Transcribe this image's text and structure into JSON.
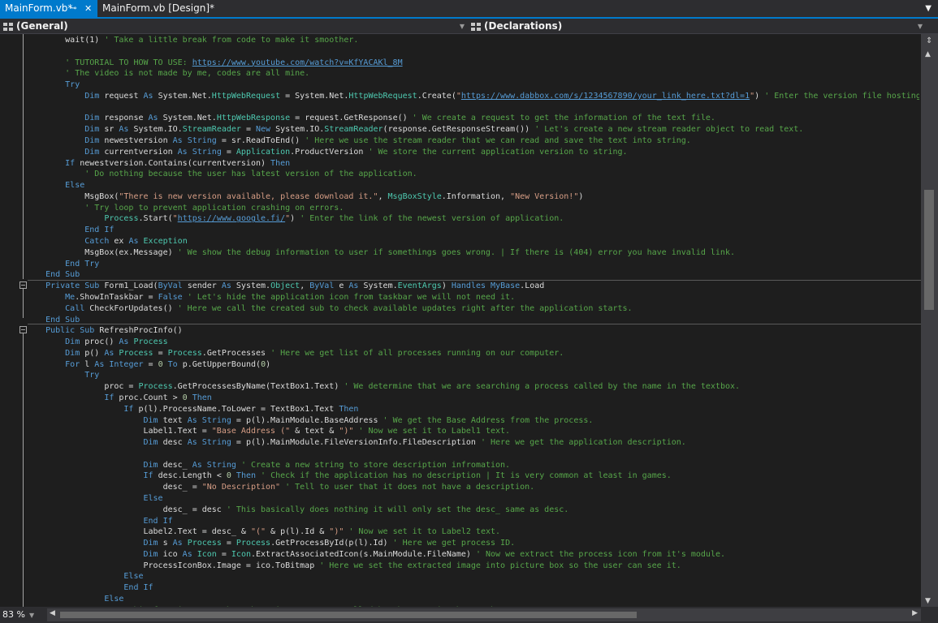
{
  "tabs": [
    {
      "label": "MainForm.vb*",
      "active": true,
      "pin_icon": "pin-icon",
      "close_icon": "close-icon"
    },
    {
      "label": "MainForm.vb [Design]*",
      "active": false
    }
  ],
  "navigation": {
    "left_label": "(General)",
    "right_label": "(Declarations)"
  },
  "zoom": "83 %",
  "colors": {
    "accent": "#007acc",
    "background": "#1e1e1e",
    "keyword": "#569cd6",
    "type": "#4ec9b0",
    "string": "#d69d85",
    "comment": "#57a64a"
  },
  "code_lines": [
    [
      [
        "p",
        "        wait(1) "
      ],
      [
        "c",
        "' Take a little break from code to make it smoother."
      ]
    ],
    [
      [
        "p",
        ""
      ]
    ],
    [
      [
        "c",
        "        ' TUTORIAL TO HOW TO USE: "
      ],
      [
        "u",
        "https://www.youtube.com/watch?v=KfYACAKl_8M"
      ]
    ],
    [
      [
        "c",
        "        ' The video is not made by me, codes are all mine."
      ]
    ],
    [
      [
        "k",
        "        Try"
      ]
    ],
    [
      [
        "k",
        "            Dim"
      ],
      [
        "p",
        " request "
      ],
      [
        "k",
        "As"
      ],
      [
        "p",
        " System.Net."
      ],
      [
        "t",
        "HttpWebRequest"
      ],
      [
        "p",
        " = System.Net."
      ],
      [
        "t",
        "HttpWebRequest"
      ],
      [
        "p",
        ".Create("
      ],
      [
        "s",
        "\""
      ],
      [
        "u",
        "https://www.dabbox.com/s/1234567890/your_link_here.txt?dl=1"
      ],
      [
        "s",
        "\""
      ],
      [
        "p",
        ") "
      ],
      [
        "c",
        "' Enter the version file hosting site li"
      ]
    ],
    [
      [
        "p",
        ""
      ]
    ],
    [
      [
        "k",
        "            Dim"
      ],
      [
        "p",
        " response "
      ],
      [
        "k",
        "As"
      ],
      [
        "p",
        " System.Net."
      ],
      [
        "t",
        "HttpWebResponse"
      ],
      [
        "p",
        " = request.GetResponse() "
      ],
      [
        "c",
        "' We create a request to get the information of the text file."
      ]
    ],
    [
      [
        "k",
        "            Dim"
      ],
      [
        "p",
        " sr "
      ],
      [
        "k",
        "As"
      ],
      [
        "p",
        " System.IO."
      ],
      [
        "t",
        "StreamReader"
      ],
      [
        "p",
        " = "
      ],
      [
        "k",
        "New"
      ],
      [
        "p",
        " System.IO."
      ],
      [
        "t",
        "StreamReader"
      ],
      [
        "p",
        "(response.GetResponseStream()) "
      ],
      [
        "c",
        "' Let's create a new stream reader object to read text."
      ]
    ],
    [
      [
        "k",
        "            Dim"
      ],
      [
        "p",
        " newestversion "
      ],
      [
        "k",
        "As"
      ],
      [
        "p",
        " "
      ],
      [
        "k",
        "String"
      ],
      [
        "p",
        " = sr.ReadToEnd() "
      ],
      [
        "c",
        "' Here we use the stream reader that we can read and save the text into string."
      ]
    ],
    [
      [
        "k",
        "            Dim"
      ],
      [
        "p",
        " currentversion "
      ],
      [
        "k",
        "As"
      ],
      [
        "p",
        " "
      ],
      [
        "k",
        "String"
      ],
      [
        "p",
        " = "
      ],
      [
        "t",
        "Application"
      ],
      [
        "p",
        ".ProductVersion "
      ],
      [
        "c",
        "' We store the current application version to string."
      ]
    ],
    [
      [
        "k",
        "        If"
      ],
      [
        "p",
        " newestversion.Contains(currentversion) "
      ],
      [
        "k",
        "Then"
      ]
    ],
    [
      [
        "c",
        "            ' Do nothing because the user has latest version of the application."
      ]
    ],
    [
      [
        "k",
        "        Else"
      ]
    ],
    [
      [
        "p",
        "            MsgBox("
      ],
      [
        "s",
        "\"There is new version available, please download it.\""
      ],
      [
        "p",
        ", "
      ],
      [
        "t",
        "MsgBoxStyle"
      ],
      [
        "p",
        ".Information, "
      ],
      [
        "s",
        "\"New Version!\""
      ],
      [
        "p",
        ")"
      ]
    ],
    [
      [
        "c",
        "            ' Try loop to prevent application crashing on errors."
      ]
    ],
    [
      [
        "p",
        "                "
      ],
      [
        "t",
        "Process"
      ],
      [
        "p",
        ".Start("
      ],
      [
        "s",
        "\""
      ],
      [
        "u",
        "https://www.google.fi/"
      ],
      [
        "s",
        "\""
      ],
      [
        "p",
        ") "
      ],
      [
        "c",
        "' Enter the link of the newest version of application."
      ]
    ],
    [
      [
        "k",
        "            End If"
      ]
    ],
    [
      [
        "k",
        "            Catch"
      ],
      [
        "p",
        " ex "
      ],
      [
        "k",
        "As"
      ],
      [
        "p",
        " "
      ],
      [
        "t",
        "Exception"
      ]
    ],
    [
      [
        "p",
        "            MsgBox(ex.Message) "
      ],
      [
        "c",
        "' We show the debug information to user if somethings goes wrong. | If there is (404) error you have invalid link."
      ]
    ],
    [
      [
        "k",
        "        End Try"
      ]
    ],
    [
      [
        "k",
        "    End Sub"
      ]
    ],
    [
      [
        "k",
        "    Private Sub"
      ],
      [
        "p",
        " Form1_Load("
      ],
      [
        "k",
        "ByVal"
      ],
      [
        "p",
        " sender "
      ],
      [
        "k",
        "As"
      ],
      [
        "p",
        " System."
      ],
      [
        "t",
        "Object"
      ],
      [
        "p",
        ", "
      ],
      [
        "k",
        "ByVal"
      ],
      [
        "p",
        " e "
      ],
      [
        "k",
        "As"
      ],
      [
        "p",
        " System."
      ],
      [
        "t",
        "EventArgs"
      ],
      [
        "p",
        ") "
      ],
      [
        "k",
        "Handles"
      ],
      [
        "p",
        " "
      ],
      [
        "k",
        "MyBase"
      ],
      [
        "p",
        ".Load"
      ]
    ],
    [
      [
        "k",
        "        Me"
      ],
      [
        "p",
        ".ShowInTaskbar = "
      ],
      [
        "k",
        "False"
      ],
      [
        "p",
        " "
      ],
      [
        "c",
        "' Let's hide the application icon from taskbar we will not need it."
      ]
    ],
    [
      [
        "k",
        "        Call"
      ],
      [
        "p",
        " CheckForUpdates() "
      ],
      [
        "c",
        "' Here we call the created sub to check available updates right after the application starts."
      ]
    ],
    [
      [
        "k",
        "    End Sub"
      ]
    ],
    [
      [
        "k",
        "    Public Sub"
      ],
      [
        "p",
        " RefreshProcInfo()"
      ]
    ],
    [
      [
        "k",
        "        Dim"
      ],
      [
        "p",
        " proc() "
      ],
      [
        "k",
        "As"
      ],
      [
        "p",
        " "
      ],
      [
        "t",
        "Process"
      ]
    ],
    [
      [
        "k",
        "        Dim"
      ],
      [
        "p",
        " p() "
      ],
      [
        "k",
        "As"
      ],
      [
        "p",
        " "
      ],
      [
        "t",
        "Process"
      ],
      [
        "p",
        " = "
      ],
      [
        "t",
        "Process"
      ],
      [
        "p",
        ".GetProcesses "
      ],
      [
        "c",
        "' Here we get list of all processes running on our computer."
      ]
    ],
    [
      [
        "k",
        "        For"
      ],
      [
        "p",
        " l "
      ],
      [
        "k",
        "As"
      ],
      [
        "p",
        " "
      ],
      [
        "k",
        "Integer"
      ],
      [
        "p",
        " = "
      ],
      [
        "n",
        "0"
      ],
      [
        "p",
        " "
      ],
      [
        "k",
        "To"
      ],
      [
        "p",
        " p.GetUpperBound("
      ],
      [
        "n",
        "0"
      ],
      [
        "p",
        ")"
      ]
    ],
    [
      [
        "k",
        "            Try"
      ]
    ],
    [
      [
        "p",
        "                proc = "
      ],
      [
        "t",
        "Process"
      ],
      [
        "p",
        ".GetProcessesByName(TextBox1.Text) "
      ],
      [
        "c",
        "' We determine that we are searching a process called by the name in the textbox."
      ]
    ],
    [
      [
        "k",
        "                If"
      ],
      [
        "p",
        " proc.Count > "
      ],
      [
        "n",
        "0"
      ],
      [
        "p",
        " "
      ],
      [
        "k",
        "Then"
      ]
    ],
    [
      [
        "k",
        "                    If"
      ],
      [
        "p",
        " p(l).ProcessName.ToLower = TextBox1.Text "
      ],
      [
        "k",
        "Then"
      ]
    ],
    [
      [
        "k",
        "                        Dim"
      ],
      [
        "p",
        " text "
      ],
      [
        "k",
        "As"
      ],
      [
        "p",
        " "
      ],
      [
        "k",
        "String"
      ],
      [
        "p",
        " = p(l).MainModule.BaseAddress "
      ],
      [
        "c",
        "' We get the Base Address from the process."
      ]
    ],
    [
      [
        "p",
        "                        Label1.Text = "
      ],
      [
        "s",
        "\"Base Address (\""
      ],
      [
        "p",
        " & text & "
      ],
      [
        "s",
        "\")\""
      ],
      [
        "p",
        " "
      ],
      [
        "c",
        "' Now we set it to Label1 text."
      ]
    ],
    [
      [
        "k",
        "                        Dim"
      ],
      [
        "p",
        " desc "
      ],
      [
        "k",
        "As"
      ],
      [
        "p",
        " "
      ],
      [
        "k",
        "String"
      ],
      [
        "p",
        " = p(l).MainModule.FileVersionInfo.FileDescription "
      ],
      [
        "c",
        "' Here we get the application description."
      ]
    ],
    [
      [
        "p",
        ""
      ]
    ],
    [
      [
        "k",
        "                        Dim"
      ],
      [
        "p",
        " desc_ "
      ],
      [
        "k",
        "As"
      ],
      [
        "p",
        " "
      ],
      [
        "k",
        "String"
      ],
      [
        "p",
        " "
      ],
      [
        "c",
        "' Create a new string to store description infromation."
      ]
    ],
    [
      [
        "k",
        "                        If"
      ],
      [
        "p",
        " desc.Length < "
      ],
      [
        "n",
        "0"
      ],
      [
        "p",
        " "
      ],
      [
        "k",
        "Then"
      ],
      [
        "p",
        " "
      ],
      [
        "c",
        "' Check if the application has no description | It is very common at least in games."
      ]
    ],
    [
      [
        "p",
        "                            desc_ = "
      ],
      [
        "s",
        "\"No Description\""
      ],
      [
        "p",
        " "
      ],
      [
        "c",
        "' Tell to user that it does not have a description."
      ]
    ],
    [
      [
        "k",
        "                        Else"
      ]
    ],
    [
      [
        "p",
        "                            desc_ = desc "
      ],
      [
        "c",
        "' This basically does nothing it will only set the desc_ same as desc."
      ]
    ],
    [
      [
        "k",
        "                        End If"
      ]
    ],
    [
      [
        "p",
        "                        Label2.Text = desc_ & "
      ],
      [
        "s",
        "\"(\""
      ],
      [
        "p",
        " & p(l).Id & "
      ],
      [
        "s",
        "\")\""
      ],
      [
        "p",
        " "
      ],
      [
        "c",
        "' Now we set it to Label2 text."
      ]
    ],
    [
      [
        "k",
        "                        Dim"
      ],
      [
        "p",
        " s "
      ],
      [
        "k",
        "As"
      ],
      [
        "p",
        " "
      ],
      [
        "t",
        "Process"
      ],
      [
        "p",
        " = "
      ],
      [
        "t",
        "Process"
      ],
      [
        "p",
        ".GetProcessById(p(l).Id) "
      ],
      [
        "c",
        "' Here we get process ID."
      ]
    ],
    [
      [
        "k",
        "                        Dim"
      ],
      [
        "p",
        " ico "
      ],
      [
        "k",
        "As"
      ],
      [
        "p",
        " "
      ],
      [
        "t",
        "Icon"
      ],
      [
        "p",
        " = "
      ],
      [
        "t",
        "Icon"
      ],
      [
        "p",
        ".ExtractAssociatedIcon(s.MainModule.FileName) "
      ],
      [
        "c",
        "' Now we extract the process icon from it's module."
      ]
    ],
    [
      [
        "p",
        "                        ProcessIconBox.Image = ico.ToBitmap "
      ],
      [
        "c",
        "' Here we set the extracted image into picture box so the user can see it."
      ]
    ],
    [
      [
        "k",
        "                    Else"
      ]
    ],
    [
      [
        "k",
        "                    End If"
      ]
    ],
    [
      [
        "k",
        "                Else"
      ]
    ],
    [
      [
        "c",
        "                    'This function runs when there is no process called by the name in the textbox"
      ]
    ]
  ]
}
